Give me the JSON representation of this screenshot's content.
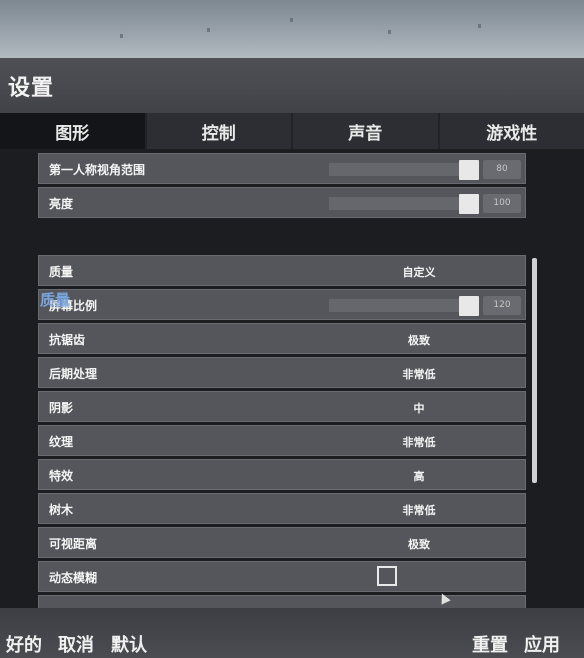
{
  "window": {
    "title": "设置"
  },
  "tabs": [
    {
      "label": "图形",
      "active": true
    },
    {
      "label": "控制",
      "active": false
    },
    {
      "label": "声音",
      "active": false
    },
    {
      "label": "游戏性",
      "active": false
    }
  ],
  "display": {
    "fov": {
      "label": "第一人称视角范围",
      "value": "80",
      "level": 0.9
    },
    "brightness": {
      "label": "亮度",
      "value": "100",
      "level": 1.0
    }
  },
  "quality_section": {
    "heading": "质量",
    "quality": {
      "label": "质量",
      "value": "自定义"
    },
    "screen_scale": {
      "label": "屏幕比例",
      "value": "120",
      "level": 1.0
    },
    "anti_aliasing": {
      "label": "抗锯齿",
      "value": "极致"
    },
    "post_processing": {
      "label": "后期处理",
      "value": "非常低"
    },
    "shadows": {
      "label": "阴影",
      "value": "中"
    },
    "textures": {
      "label": "纹理",
      "value": "非常低"
    },
    "effects": {
      "label": "特效",
      "value": "高"
    },
    "foliage": {
      "label": "树木",
      "value": "非常低"
    },
    "view_distance": {
      "label": "可视距离",
      "value": "极致"
    },
    "motion_blur": {
      "label": "动态模糊",
      "checked": false
    }
  },
  "footer": {
    "ok": "好的",
    "cancel": "取消",
    "default": "默认",
    "reset": "重置",
    "apply": "应用"
  },
  "colors": {
    "accent": "#7aa6e0",
    "row_bg": "#55565c",
    "content_bg": "#1c1d21"
  }
}
